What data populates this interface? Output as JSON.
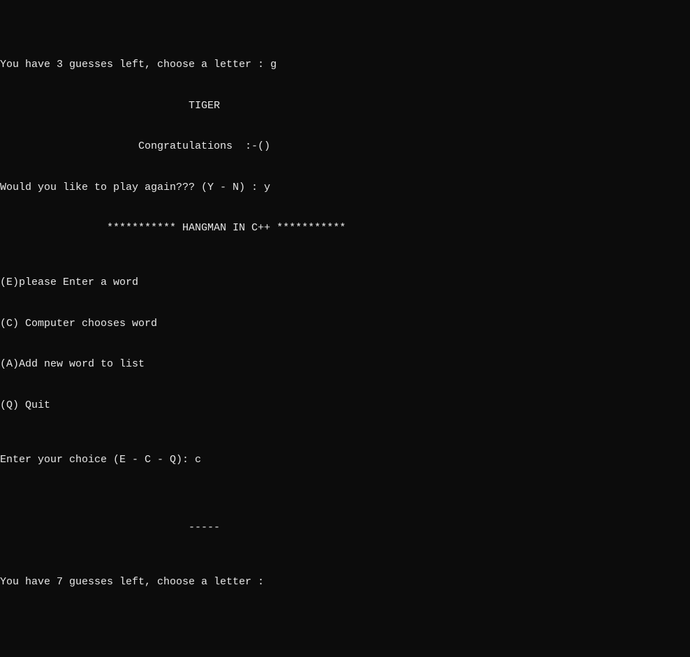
{
  "lines": {
    "guess_prompt_3": "You have 3 guesses left, choose a letter : g",
    "blank1": "",
    "tiger": "                              TIGER",
    "blank2": "",
    "congrats": "                      Congratulations  :-()",
    "blank3": "",
    "play_again": "Would you like to play again??? (Y - N) : y",
    "blank4": "",
    "title": "                 *********** HANGMAN IN C++ ***********",
    "blank5": "",
    "blank6": "",
    "menu_e": "(E)please Enter a word",
    "blank7": "",
    "menu_c": "(C) Computer chooses word",
    "blank8": "",
    "menu_a": "(A)Add new word to list",
    "blank9": "",
    "menu_q": "(Q) Quit",
    "blank10": "",
    "blank11": "",
    "choice_prompt": "Enter your choice (E - C - Q): c",
    "blank12": "",
    "blank13": "",
    "blank14": "",
    "dashes": "                              -----",
    "blank15": "",
    "blank16": "",
    "guess_prompt_7": "You have 7 guesses left, choose a letter :"
  }
}
